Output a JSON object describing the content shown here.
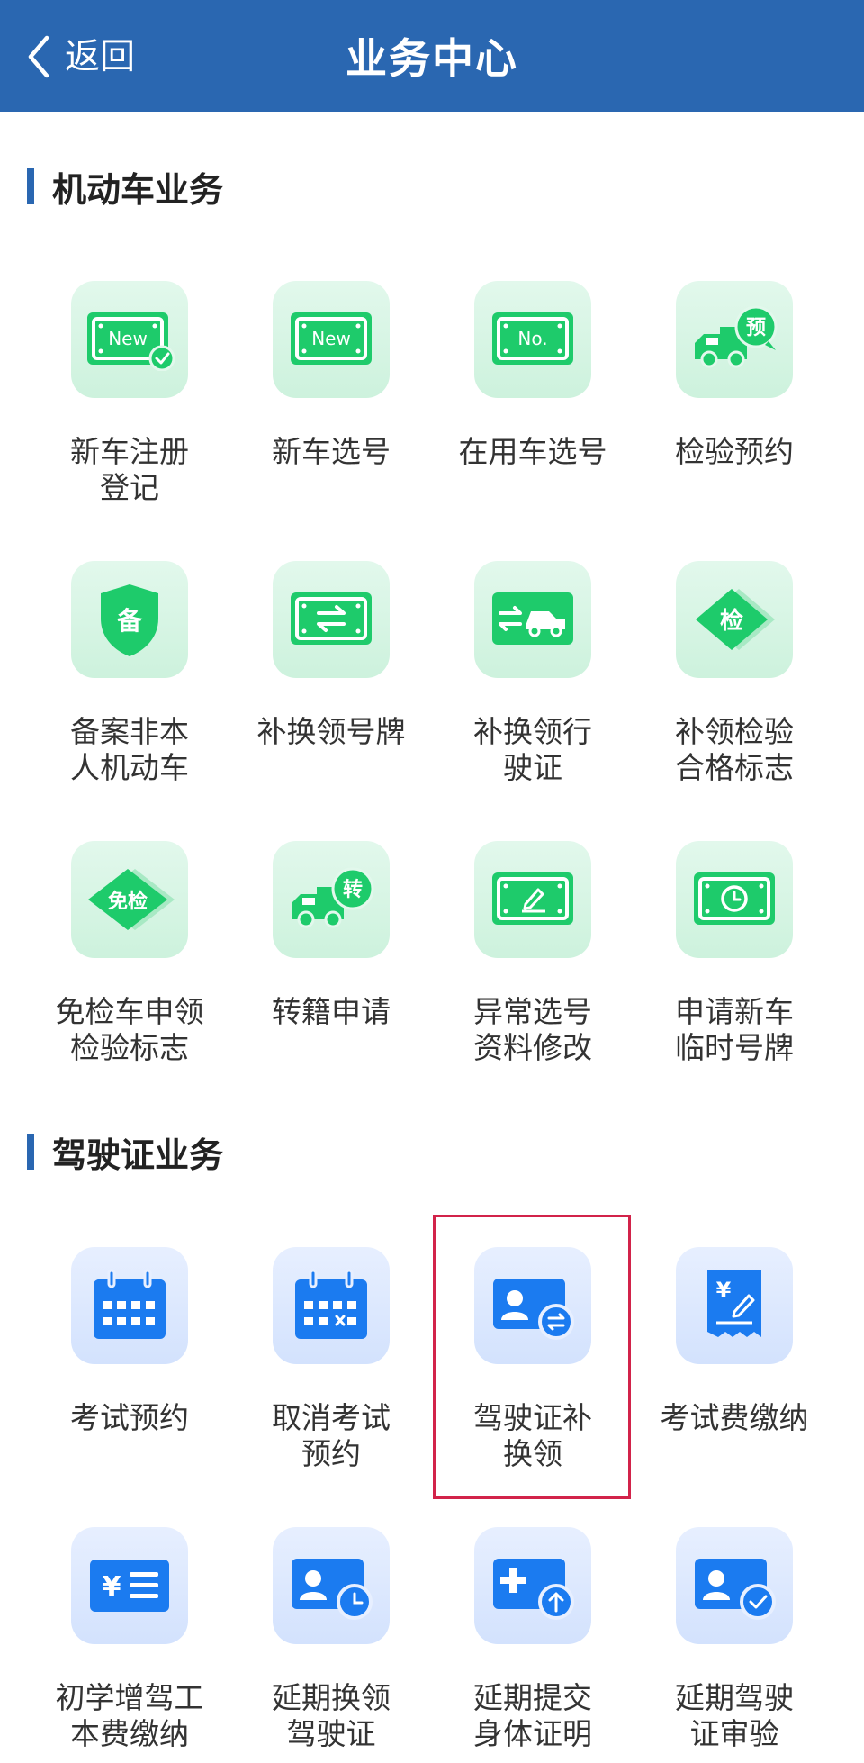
{
  "header": {
    "back_label": "返回",
    "title": "业务中心"
  },
  "colors": {
    "header": "#2a67b1",
    "green": "#1ecb6b",
    "blue": "#1b7bf0",
    "highlight": "#d2234a"
  },
  "sections": [
    {
      "title": "机动车业务",
      "items": [
        {
          "label": "新车注册\n登记",
          "icon": "new-plate-check-icon",
          "plate_text": "New"
        },
        {
          "label": "新车选号",
          "icon": "new-plate-icon",
          "plate_text": "New"
        },
        {
          "label": "在用车选号",
          "icon": "number-plate-icon",
          "plate_text": "No."
        },
        {
          "label": "检验预约",
          "icon": "truck-reserve-icon",
          "badge_text": "预"
        },
        {
          "label": "备案非本\n人机动车",
          "icon": "shield-record-icon",
          "badge_text": "备"
        },
        {
          "label": "补换领号牌",
          "icon": "plate-exchange-icon"
        },
        {
          "label": "补换领行\n驶证",
          "icon": "license-car-exchange-icon"
        },
        {
          "label": "补领检验\n合格标志",
          "icon": "inspection-diamond-icon",
          "badge_text": "检"
        },
        {
          "label": "免检车申领\n检验标志",
          "icon": "exempt-diamond-icon",
          "badge_text": "免检"
        },
        {
          "label": "转籍申请",
          "icon": "truck-transfer-icon",
          "badge_text": "转"
        },
        {
          "label": "异常选号\n资料修改",
          "icon": "plate-edit-icon"
        },
        {
          "label": "申请新车\n临时号牌",
          "icon": "plate-clock-icon"
        }
      ]
    },
    {
      "title": "驾驶证业务",
      "items": [
        {
          "label": "考试预约",
          "icon": "calendar-icon"
        },
        {
          "label": "取消考试\n预约",
          "icon": "calendar-cancel-icon"
        },
        {
          "label": "驾驶证补\n换领",
          "icon": "license-exchange-icon"
        },
        {
          "label": "考试费缴纳",
          "icon": "fee-receipt-icon",
          "badge_text": "¥"
        },
        {
          "label": "初学增驾工\n本费缴纳",
          "icon": "fee-list-icon",
          "badge_text": "¥"
        },
        {
          "label": "延期换领\n驾驶证",
          "icon": "license-clock-icon"
        },
        {
          "label": "延期提交\n身体证明",
          "icon": "medical-upload-icon"
        },
        {
          "label": "延期驾驶\n证审验",
          "icon": "license-verify-icon"
        }
      ]
    }
  ]
}
